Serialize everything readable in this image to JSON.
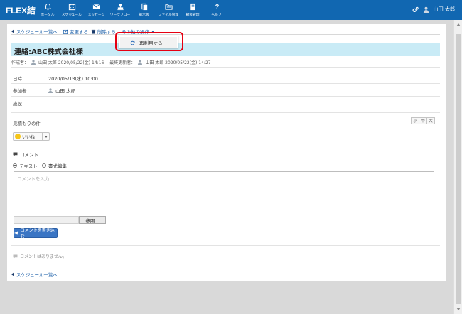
{
  "app": {
    "logo": "FLEX結"
  },
  "nav": [
    {
      "label": "ポータル",
      "icon": "bell-icon"
    },
    {
      "label": "スケジュール",
      "icon": "calendar-icon"
    },
    {
      "label": "メッセージ",
      "icon": "mail-icon"
    },
    {
      "label": "ワークフロー",
      "icon": "stamp-icon"
    },
    {
      "label": "掲示板",
      "icon": "board-icon"
    },
    {
      "label": "ファイル管理",
      "icon": "folder-icon"
    },
    {
      "label": "顧客管理",
      "icon": "book-icon"
    },
    {
      "label": "ヘルプ",
      "icon": "help-icon"
    }
  ],
  "user": {
    "name": "山田 太郎"
  },
  "toolbar": {
    "back": "スケジュール一覧へ",
    "edit": "変更する",
    "delete": "削除する",
    "other": "その他の操作"
  },
  "dropdown": {
    "reuse": "再利用する"
  },
  "title": "連絡:ABC株式会社様",
  "meta": {
    "author_label": "作成者：",
    "author": "山田 太郎 2020/05/22(金) 14:16",
    "updater_label": "最終更新者：",
    "updater": "山田 太郎 2020/05/22(金) 14:27"
  },
  "fields": {
    "datetime_label": "日時",
    "datetime": "2020/05/13(水) 10:00",
    "participants_label": "参加者",
    "participant": "山田 太郎",
    "facility_label": "施設"
  },
  "body_title": "見積もりの件",
  "font_sizes": [
    "小",
    "中",
    "大"
  ],
  "like": {
    "label": "いいね！"
  },
  "comment": {
    "heading": "コメント",
    "mode_text": "テキスト",
    "mode_rich": "書式編集",
    "placeholder": "コメントを入力...",
    "browse": "参照...",
    "post": "コメントを書き込む",
    "none": "コメントはありません。"
  },
  "footer_back": "スケジュール一覧へ",
  "colors": {
    "topbar": "#1167b1",
    "title_bg": "#c9ebf6",
    "highlight": "#e60012",
    "post_button": "#3a75c4"
  }
}
